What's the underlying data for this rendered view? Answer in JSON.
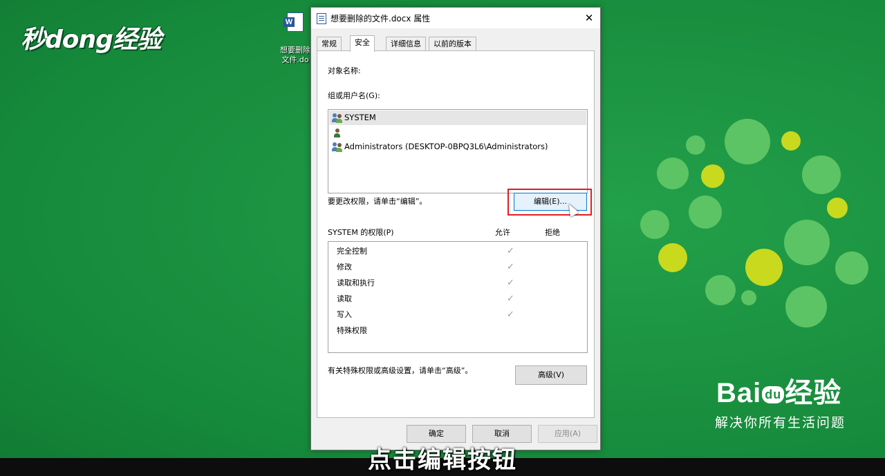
{
  "overlay": {
    "logo_text": "秒dong经验",
    "subtitle": "点击编辑按钮",
    "baidu_logo_prefix": "Bai",
    "baidu_logo_paw": "du",
    "baidu_logo_suffix": "经验",
    "baidu_slogan": "解决你所有生活问题"
  },
  "desktop": {
    "icon_label_line1": "想要删除",
    "icon_label_line2": "文件.do",
    "icon_glyph": "W"
  },
  "dialog": {
    "title": "想要删除的文件.docx 属性",
    "close_glyph": "✕",
    "tabs": [
      "常规",
      "安全",
      "详细信息",
      "以前的版本"
    ],
    "active_tab": "安全",
    "object_name_label": "对象名称:",
    "groups_label": "组或用户名(G):",
    "users": [
      {
        "name": "SYSTEM",
        "icon": "users-group-icon"
      },
      {
        "name": "",
        "icon": "user-icon"
      },
      {
        "name": "Administrators (DESKTOP-0BPQ3L6\\Administrators)",
        "icon": "users-group-icon"
      }
    ],
    "change_perm_hint": "要更改权限，请单击“编辑”。",
    "edit_button": "编辑(E)...",
    "perm_label": "SYSTEM 的权限(P)",
    "allow_header": "允许",
    "deny_header": "拒绝",
    "permissions": [
      {
        "name": "完全控制",
        "allow": "✓"
      },
      {
        "name": "修改",
        "allow": "✓"
      },
      {
        "name": "读取和执行",
        "allow": "✓"
      },
      {
        "name": "读取",
        "allow": "✓"
      },
      {
        "name": "写入",
        "allow": "✓"
      },
      {
        "name": "特殊权限",
        "allow": ""
      }
    ],
    "advanced_hint": "有关特殊权限或高级设置，请单击“高级”。",
    "advanced_button": "高级(V)",
    "ok_button": "确定",
    "cancel_button": "取消",
    "apply_button": "应用(A)"
  },
  "colors": {
    "background": "#1a9140",
    "highlight": "#e31b23",
    "accent": "#0078d7"
  }
}
